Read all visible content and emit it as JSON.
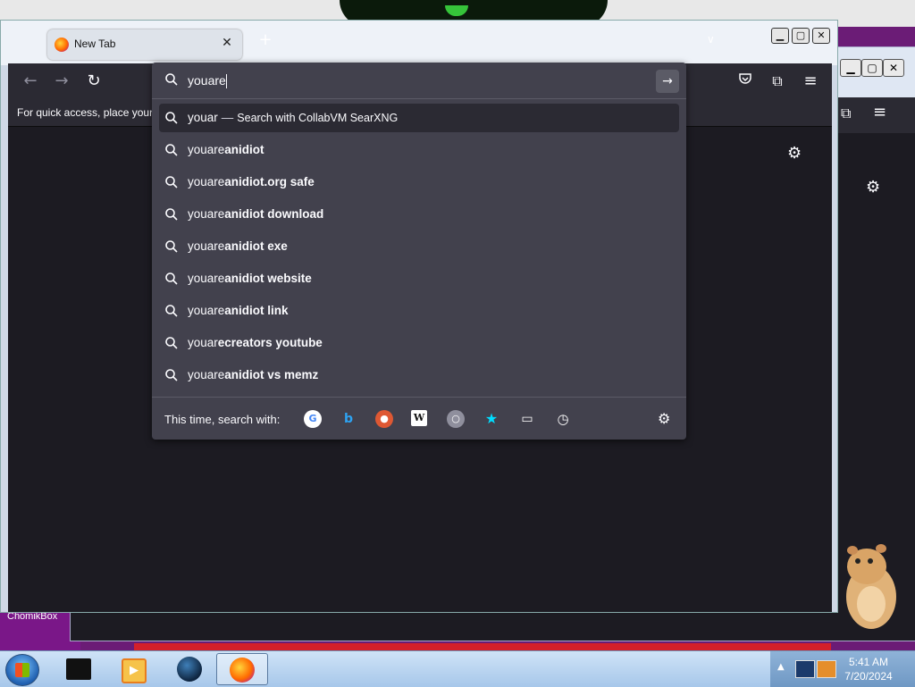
{
  "desktop": {
    "label": "ChomikBox"
  },
  "browser": {
    "tab": {
      "title": "New Tab",
      "close": "✕"
    },
    "new_tab": "+",
    "list_all_tabs": "∨",
    "window_controls": {
      "minimize": "▁",
      "maximize": "▢",
      "close": "✕"
    },
    "nav": {
      "back": "←",
      "forward": "→",
      "reload": "↻"
    },
    "toolbar_icons": [
      "pocket-icon",
      "extensions-icon",
      "menu-icon"
    ],
    "bookmarks_bar_text": "For quick access, place your b",
    "urlbar": {
      "value": "youare",
      "go": "→"
    },
    "suggestions": [
      {
        "typed": "youar",
        "bold": "",
        "action": "Search with CollabVM SearXNG",
        "selected": true
      },
      {
        "typed": "youare",
        "bold": "anidiot"
      },
      {
        "typed": "youare",
        "bold": "anidiot.org safe"
      },
      {
        "typed": "youare",
        "bold": "anidiot download"
      },
      {
        "typed": "youare",
        "bold": "anidiot exe"
      },
      {
        "typed": "youare",
        "bold": "anidiot website"
      },
      {
        "typed": "youare",
        "bold": "anidiot link"
      },
      {
        "typed": "youar",
        "bold": "ecreators youtube"
      },
      {
        "typed": "youare",
        "bold": "anidiot vs memz"
      }
    ],
    "search_with_label": "This time, search with:",
    "engines": [
      "google-icon",
      "bing-icon",
      "duckduckgo-icon",
      "wikipedia-icon",
      "searxng-icon",
      "bookmarks-icon",
      "tabs-icon",
      "history-icon"
    ],
    "colors": {
      "panel": "#42414d",
      "toolbar": "#2b2a33",
      "content": "#1c1b22"
    }
  },
  "taskbar": {
    "time": "5:41 AM",
    "date": "7/20/2024"
  }
}
